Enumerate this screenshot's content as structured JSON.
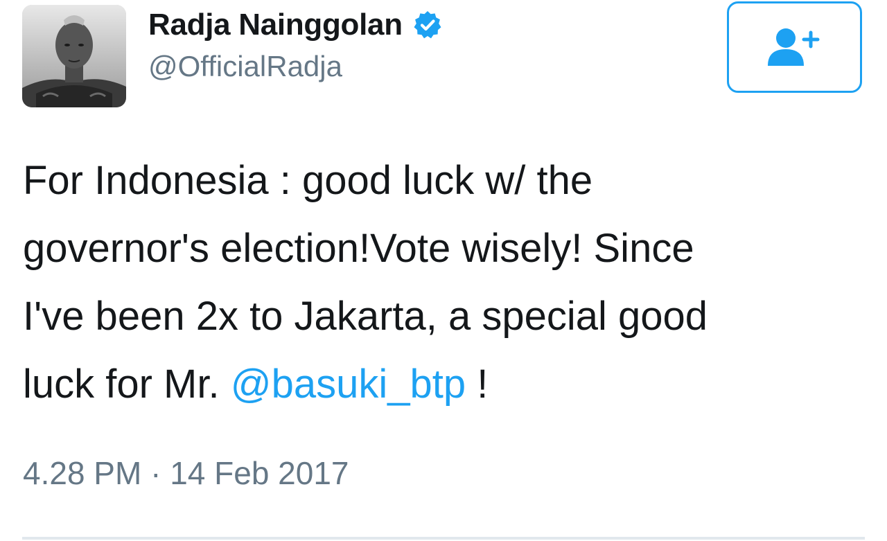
{
  "author": {
    "display_name": "Radja Nainggolan",
    "handle": "@OfficialRadja",
    "verified": true,
    "avatar_icon": "profile-photo"
  },
  "follow_button": {
    "icon": "follow-user-plus-icon"
  },
  "tweet": {
    "lines": [
      "For Indonesia : good luck w/ the",
      "governor's election!Vote wisely! Since",
      "I've been 2x to Jakarta, a special good",
      "luck for Mr. "
    ],
    "mention": "@basuki_btp",
    "after_mention": " !",
    "timestamp": "4.28 PM · 14 Feb 2017"
  },
  "colors": {
    "accent": "#1da1f2",
    "text": "#14171a",
    "secondary_text": "#657786",
    "divider": "#e1e8ed"
  }
}
